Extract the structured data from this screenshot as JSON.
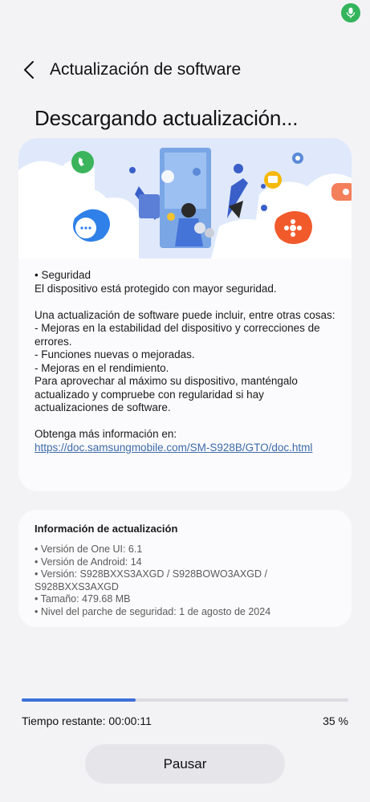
{
  "header": {
    "title": "Actualización de software"
  },
  "page": {
    "title": "Descargando actualización..."
  },
  "release_notes": {
    "lines": [
      "• Seguridad",
      "El dispositivo está protegido con mayor seguridad.",
      "",
      "Una actualización de software puede incluir, entre otras cosas:",
      " - Mejoras en la estabilidad del dispositivo y correcciones de errores.",
      " - Funciones nuevas o mejoradas.",
      " - Mejoras en el rendimiento.",
      "Para aprovechar al máximo su dispositivo, manténgalo actualizado y compruebe con regularidad si hay actualizaciones de software.",
      ""
    ],
    "more_info_label": "Obtenga más información en:",
    "more_info_url": "https://doc.samsungmobile.com/SM-S928B/GTO/doc.html"
  },
  "update_info": {
    "title": "Información de actualización",
    "items": [
      "• Versión de One UI: 6.1",
      "• Versión de Android: 14",
      "• Versión: S928BXXS3AXGD / S928BOWO3AXGD / S928BXXS3AXGD",
      "• Tamaño: 479.68 MB",
      "• Nivel del parche de seguridad: 1 de agosto de 2024"
    ]
  },
  "progress": {
    "fraction": 0.35,
    "time_remaining": "Tiempo restante: 00:00:11",
    "percent_label": "35 %"
  },
  "actions": {
    "pause_label": "Pausar"
  },
  "colors": {
    "accent": "#3e6fd8",
    "link": "#3d6aa8",
    "background": "#f3f3f6",
    "card": "#fbfbfd"
  },
  "icons": {
    "status": "microphone-icon",
    "back": "back-arrow-icon"
  }
}
